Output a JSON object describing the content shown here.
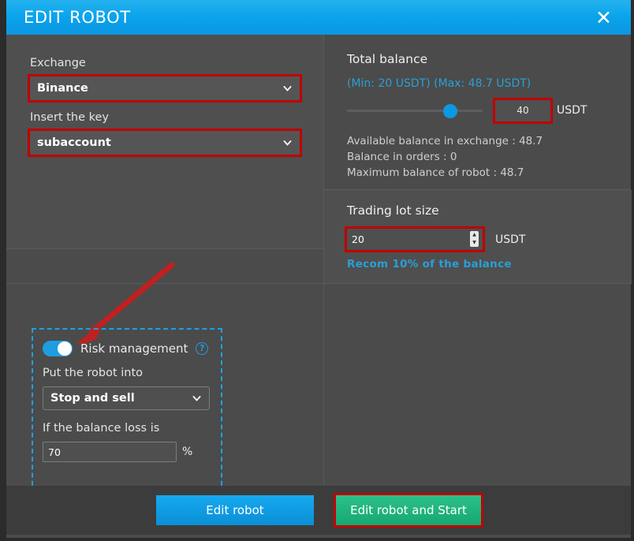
{
  "header": {
    "title": "EDIT ROBOT",
    "close_icon": "close-icon",
    "accent_color": "#0aa3ec"
  },
  "left_panel": {
    "exchange": {
      "label": "Exchange",
      "selected": "Binance",
      "chevron_icon": "chevron-down-icon",
      "highlight_color": "#c00000"
    },
    "key": {
      "label": "Insert the key",
      "selected": "subaccount",
      "chevron_icon": "chevron-down-icon",
      "highlight_color": "#c00000"
    },
    "annotation": {
      "arrow_icon": "arrow-pointer-icon",
      "arrow_color": "#c02020"
    },
    "risk_management": {
      "toggle_label": "Risk management",
      "toggle_on": true,
      "toggle_color": "#1f9de0",
      "help_icon": "question-mark-icon",
      "box_outline_color": "#1e9fe0",
      "action_label": "Put the robot into",
      "action_selected": "Stop and sell",
      "chevron_icon": "chevron-down-icon",
      "loss_label": "If the balance loss is",
      "loss_value": "70",
      "loss_unit": "%"
    }
  },
  "right_panel": {
    "total_balance": {
      "title": "Total balance",
      "minmax": "(Min: 20 USDT) (Max: 48.7 USDT)",
      "min": 20,
      "max": 48.7,
      "value": "40",
      "unit": "USDT",
      "slider_percent": 79,
      "highlight_color": "#c00000",
      "info": [
        "Available balance in exchange : 48.7",
        "Balance in orders : 0",
        "Maximum balance of robot : 48.7"
      ]
    },
    "trading_lot": {
      "title": "Trading lot size",
      "value": "20",
      "unit": "USDT",
      "spinner_up_icon": "caret-up-icon",
      "spinner_down_icon": "caret-down-icon",
      "recommendation": "Recom 10% of the balance",
      "highlight_color": "#c00000"
    }
  },
  "footer": {
    "edit_label": "Edit robot",
    "edit_start_label": "Edit robot and Start",
    "edit_color": "#0a8fd6",
    "edit_start_color": "#15a872",
    "highlight_color": "#c00000"
  }
}
